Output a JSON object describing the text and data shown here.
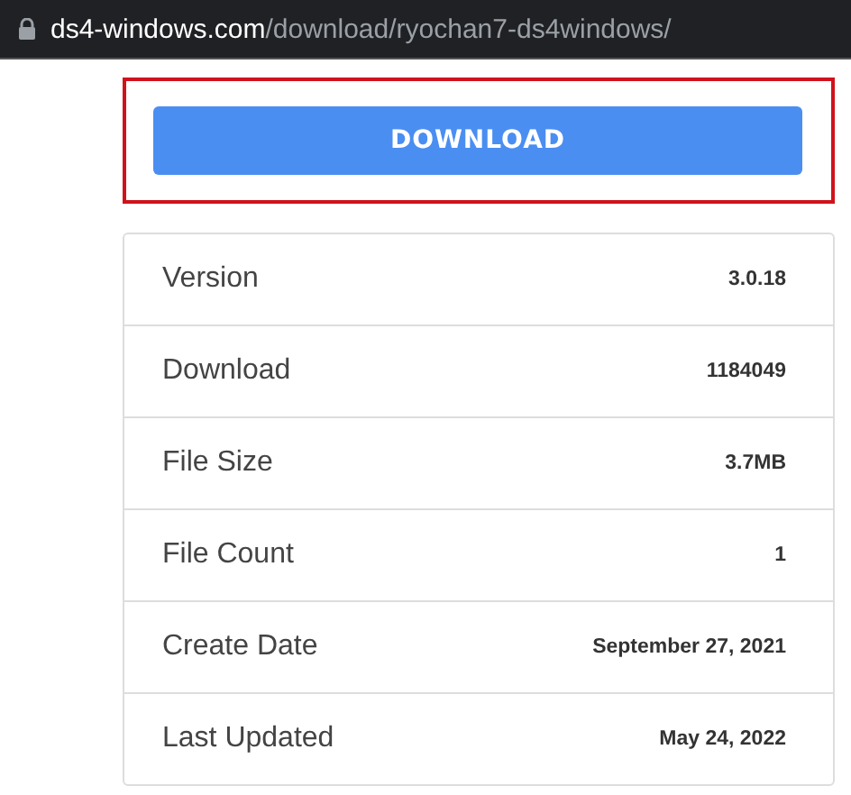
{
  "address_bar": {
    "domain": "ds4-windows.com",
    "path": "/download/ryochan7-ds4windows/"
  },
  "download_button": {
    "label": "DOWNLOAD",
    "highlighted": true
  },
  "details": [
    {
      "label": "Version",
      "value": "3.0.18"
    },
    {
      "label": "Download",
      "value": "1184049"
    },
    {
      "label": "File Size",
      "value": "3.7MB"
    },
    {
      "label": "File Count",
      "value": "1"
    },
    {
      "label": "Create Date",
      "value": "September 27, 2021"
    },
    {
      "label": "Last Updated",
      "value": "May 24, 2022"
    }
  ]
}
